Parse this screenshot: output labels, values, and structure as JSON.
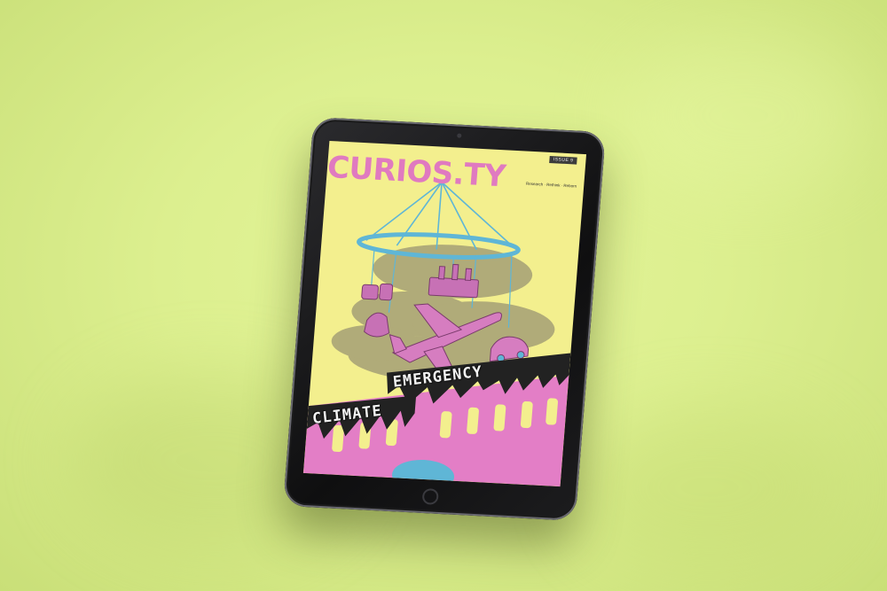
{
  "magazine": {
    "title": "CURIOS.TY",
    "issue_tag": "ISSUE 9",
    "tagline": "Research · Rethink · Reborn",
    "headline_word_1": "EMERGENCY",
    "headline_word_2": "CLIMATE"
  },
  "colors": {
    "background": "#dcef8f",
    "cover": "#f3ef8e",
    "accent_pink": "#e07ac0",
    "accent_blue": "#5fb6d6"
  },
  "icons": [
    "camera-icon",
    "home-button-icon"
  ]
}
